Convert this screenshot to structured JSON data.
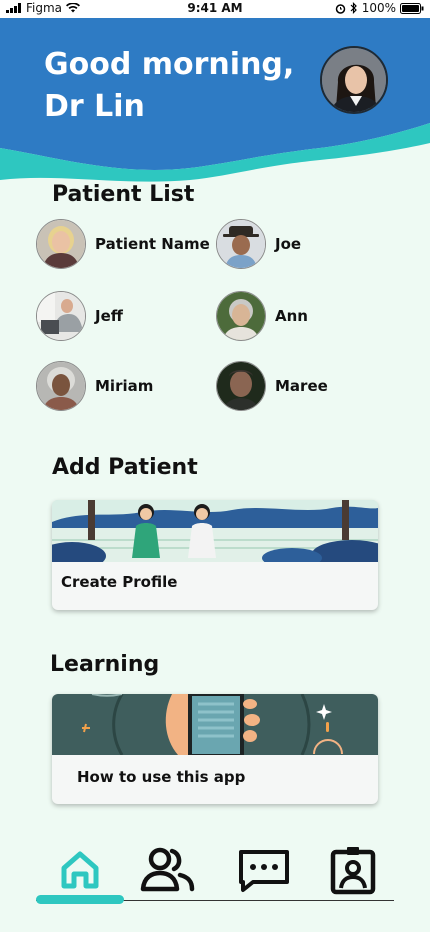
{
  "status_bar": {
    "carrier": "Figma",
    "time": "9:41 AM",
    "battery": "100%"
  },
  "header": {
    "greeting": "Good morning,",
    "doctor_name": "Dr Lin"
  },
  "patient_list": {
    "title": "Patient List",
    "patients": [
      {
        "name": "Patient Name"
      },
      {
        "name": "Joe"
      },
      {
        "name": "Jeff"
      },
      {
        "name": "Ann"
      },
      {
        "name": "Miriam"
      },
      {
        "name": "Maree"
      }
    ]
  },
  "add_patient": {
    "title": "Add Patient",
    "card_label": "Create Profile"
  },
  "learning": {
    "title": "Learning",
    "card_label": "How to use this app"
  },
  "nav": {
    "items": [
      {
        "icon": "home-icon",
        "active": true
      },
      {
        "icon": "patients-icon",
        "active": false
      },
      {
        "icon": "messages-icon",
        "active": false
      },
      {
        "icon": "profile-badge-icon",
        "active": false
      }
    ]
  },
  "colors": {
    "header_blue": "#2e7bc4",
    "accent_teal": "#2ec7c0",
    "background": "#eefaf3"
  }
}
